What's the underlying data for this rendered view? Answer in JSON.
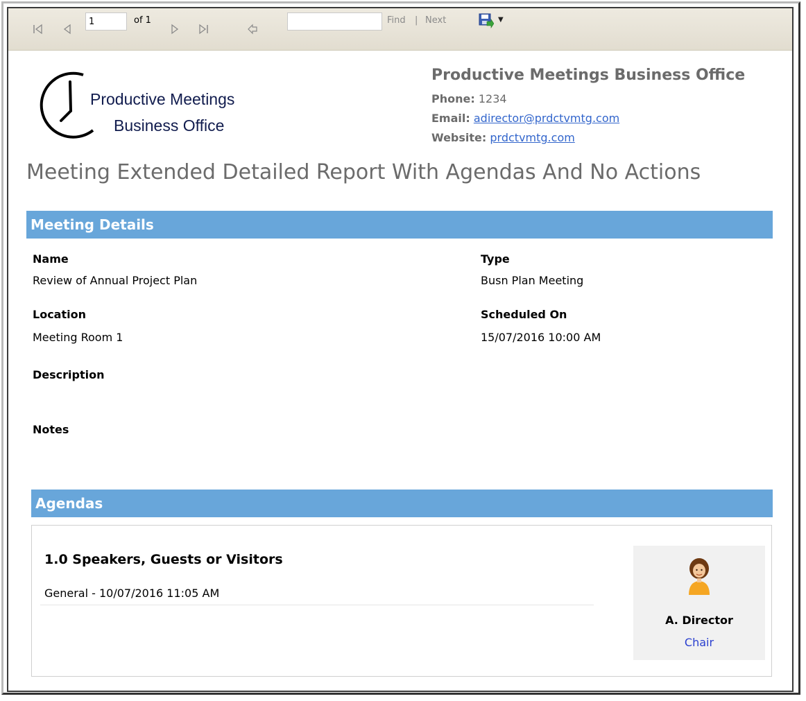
{
  "toolbar": {
    "page_number": "1",
    "page_of": "of 1",
    "find_label": "Find",
    "separator": "|",
    "next_label": "Next"
  },
  "logo": {
    "line1": "Productive Meetings",
    "line2": "Business Office"
  },
  "company": {
    "name": "Productive Meetings Business Office",
    "phone_label": "Phone:",
    "phone": "1234",
    "email_label": "Email:",
    "email": "adirector@prdctvmtg.com",
    "website_label": "Website:",
    "website": "prdctvmtg.com"
  },
  "report_title": "Meeting Extended Detailed Report With Agendas And No Actions",
  "meeting_details": {
    "heading": "Meeting Details",
    "name_label": "Name",
    "name_value": "Review of Annual Project Plan",
    "type_label": "Type",
    "type_value": "Busn Plan Meeting",
    "location_label": "Location",
    "location_value": "Meeting Room 1",
    "scheduled_label": "Scheduled On",
    "scheduled_value": "15/07/2016 10:00 AM",
    "description_label": "Description",
    "notes_label": "Notes"
  },
  "agendas": {
    "heading": "Agendas",
    "items": [
      {
        "title": "1.0 Speakers, Guests or Visitors",
        "meta": "General - 10/07/2016 11:05 AM",
        "person_name": "A. Director",
        "person_role": "Chair"
      }
    ]
  },
  "colors": {
    "section_bar": "#68a6da",
    "link": "#3366cc",
    "role": "#2a3fcf"
  }
}
